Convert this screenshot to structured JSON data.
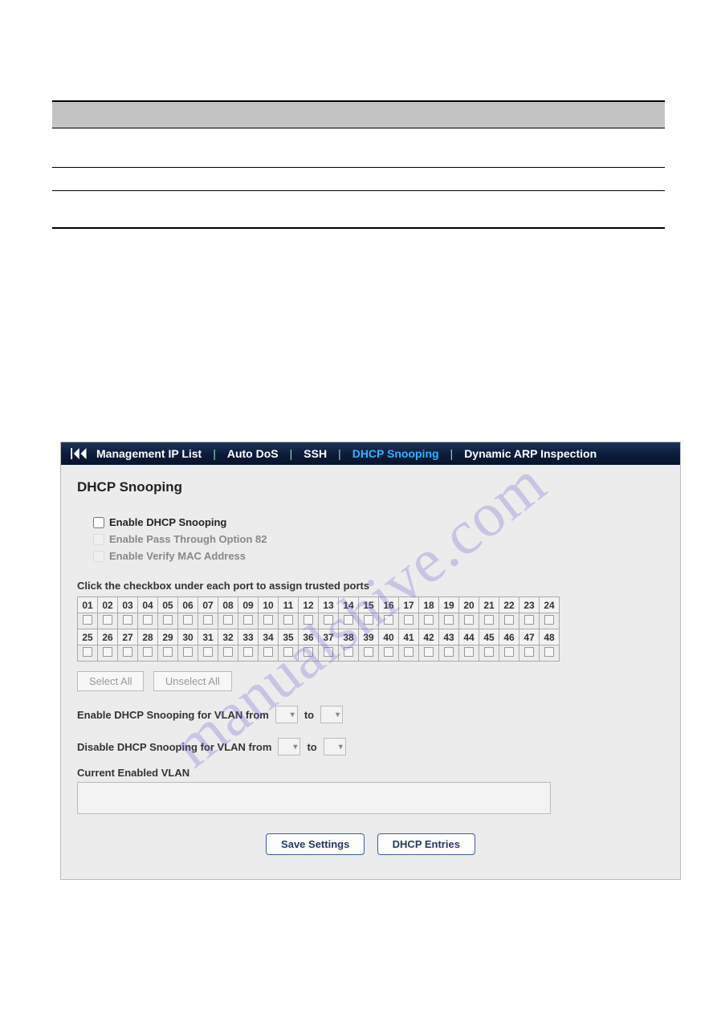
{
  "watermark": "manualshive.com",
  "tabs": {
    "items": [
      {
        "label": "Management IP List",
        "active": false
      },
      {
        "label": "Auto DoS",
        "active": false
      },
      {
        "label": "SSH",
        "active": false
      },
      {
        "label": "DHCP Snooping",
        "active": true
      },
      {
        "label": "Dynamic ARP Inspection",
        "active": false
      }
    ]
  },
  "page_title": "DHCP Snooping",
  "options": {
    "enable_snooping": "Enable DHCP Snooping",
    "enable_opt82": "Enable Pass Through Option 82",
    "enable_verify_mac": "Enable Verify MAC Address"
  },
  "ports": {
    "instruction": "Click the checkbox under each port to assign trusted ports",
    "row1": [
      "01",
      "02",
      "03",
      "04",
      "05",
      "06",
      "07",
      "08",
      "09",
      "10",
      "11",
      "12",
      "13",
      "14",
      "15",
      "16",
      "17",
      "18",
      "19",
      "20",
      "21",
      "22",
      "23",
      "24"
    ],
    "row2": [
      "25",
      "26",
      "27",
      "28",
      "29",
      "30",
      "31",
      "32",
      "33",
      "34",
      "35",
      "36",
      "37",
      "38",
      "39",
      "40",
      "41",
      "42",
      "43",
      "44",
      "45",
      "46",
      "47",
      "48"
    ]
  },
  "buttons": {
    "select_all": "Select All",
    "unselect_all": "Unselect All",
    "save": "Save Settings",
    "dhcp_entries": "DHCP Entries"
  },
  "vlan": {
    "enable_label_pre": "Enable DHCP Snooping for VLAN from",
    "disable_label_pre": "Disable DHCP Snooping for VLAN from",
    "to": "to",
    "current_label": "Current Enabled VLAN"
  }
}
